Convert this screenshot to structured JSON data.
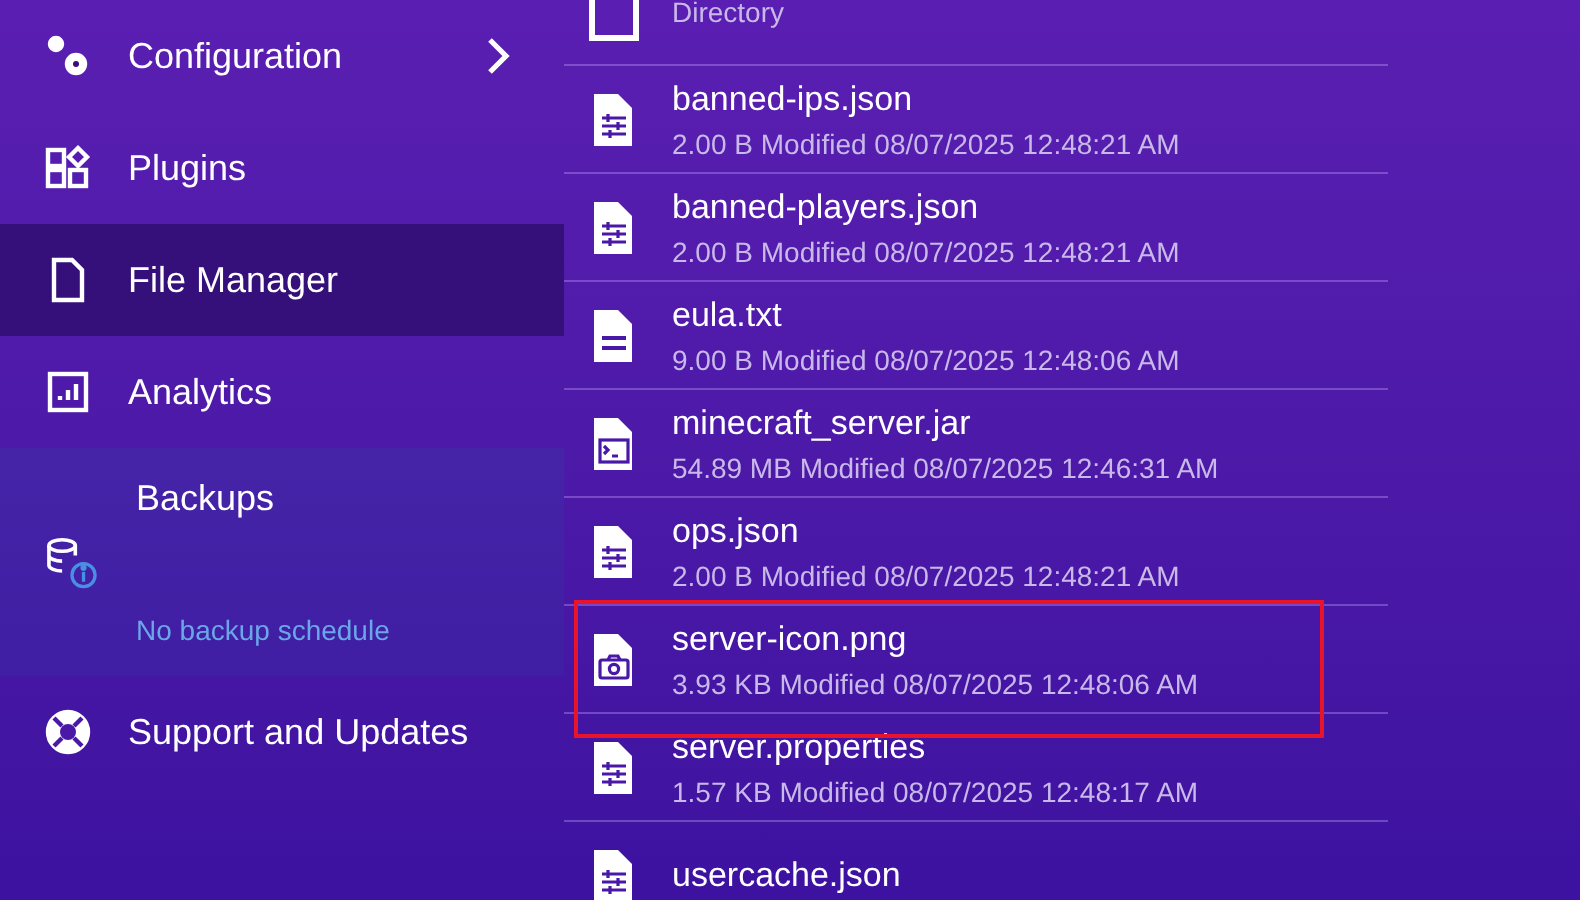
{
  "sidebar": {
    "items": [
      {
        "label": "Configuration",
        "selected": false,
        "expandable": true
      },
      {
        "label": "Plugins",
        "selected": false,
        "expandable": false
      },
      {
        "label": "File Manager",
        "selected": true,
        "expandable": false
      },
      {
        "label": "Analytics",
        "selected": false,
        "expandable": false
      },
      {
        "label": "Backups",
        "selected": false,
        "expandable": false,
        "note": "No backup schedule"
      },
      {
        "label": "Support and Updates",
        "selected": false,
        "expandable": false
      }
    ]
  },
  "files": [
    {
      "kind": "directory",
      "meta": "Directory",
      "highlighted": false
    },
    {
      "kind": "config",
      "name": "banned-ips.json",
      "meta": "2.00 B Modified 08/07/2025 12:48:21 AM",
      "highlighted": false
    },
    {
      "kind": "config",
      "name": "banned-players.json",
      "meta": "2.00 B Modified 08/07/2025 12:48:21 AM",
      "highlighted": false
    },
    {
      "kind": "text",
      "name": "eula.txt",
      "meta": "9.00 B Modified 08/07/2025 12:48:06 AM",
      "highlighted": false
    },
    {
      "kind": "executable",
      "name": "minecraft_server.jar",
      "meta": "54.89 MB Modified 08/07/2025 12:46:31 AM",
      "highlighted": false
    },
    {
      "kind": "config",
      "name": "ops.json",
      "meta": "2.00 B Modified 08/07/2025 12:48:21 AM",
      "highlighted": false
    },
    {
      "kind": "image",
      "name": "server-icon.png",
      "meta": "3.93 KB Modified 08/07/2025 12:48:06 AM",
      "highlighted": true
    },
    {
      "kind": "config",
      "name": "server.properties",
      "meta": "1.57 KB Modified 08/07/2025 12:48:17 AM",
      "highlighted": false
    },
    {
      "kind": "config",
      "name": "usercache.json",
      "highlighted": false
    }
  ]
}
